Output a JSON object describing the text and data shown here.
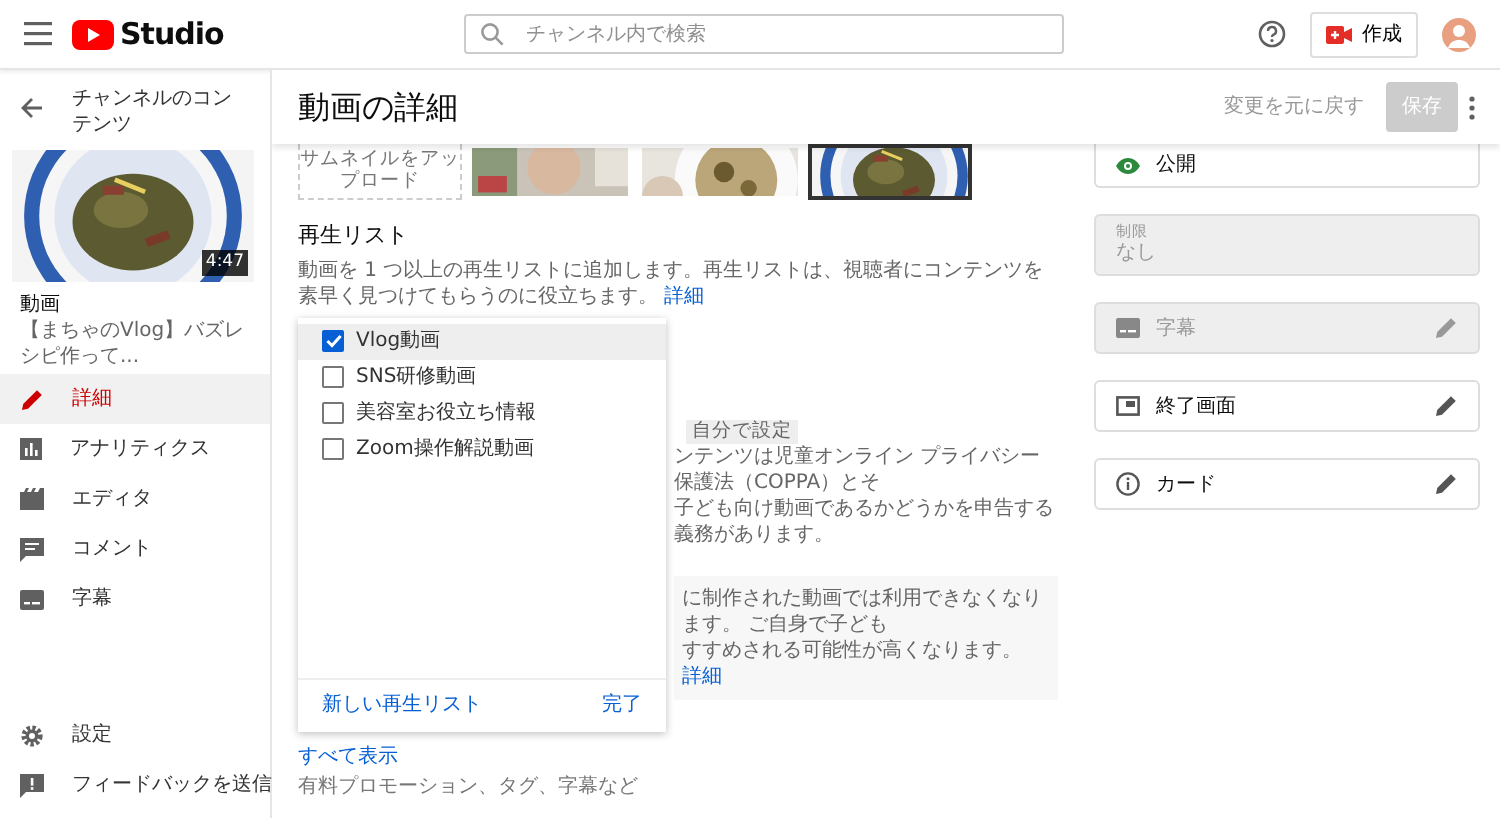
{
  "topbar": {
    "logo_text": "Studio",
    "search": {
      "placeholder": "チャンネル内で検索"
    },
    "create_button": "作成"
  },
  "sidebar": {
    "back_label": "チャンネルのコンテンツ",
    "video_duration": "4:47",
    "video_heading": "動画",
    "video_title": "【まちゃのVlog】バズレシピ作って...",
    "items": [
      {
        "label": "詳細",
        "selected": true
      },
      {
        "label": "アナリティクス",
        "selected": false
      },
      {
        "label": "エディタ",
        "selected": false
      },
      {
        "label": "コメント",
        "selected": false
      },
      {
        "label": "字幕",
        "selected": false
      }
    ],
    "footer_items": [
      {
        "label": "設定"
      },
      {
        "label": "フィードバックを送信"
      }
    ]
  },
  "header": {
    "title": "動画の詳細",
    "revert": "変更を元に戻す",
    "save": {
      "label": "保存",
      "disabled": true
    }
  },
  "thumbnails": {
    "upload_label": "サムネイルをアップロード",
    "items": [
      {
        "selected": false
      },
      {
        "selected": false
      },
      {
        "selected": true
      }
    ]
  },
  "playlists": {
    "title": "再生リスト",
    "description": "動画を 1 つ以上の再生リストに追加します。再生リストは、視聴者にコンテンツを素早く見つけてもらうのに役立ちます。",
    "link": "詳細",
    "dropdown": {
      "items": [
        {
          "label": "Vlog動画",
          "checked": true,
          "selected": true
        },
        {
          "label": "SNS研修動画",
          "checked": false,
          "selected": false
        },
        {
          "label": "美容室お役立ち情報",
          "checked": false,
          "selected": false
        },
        {
          "label": "Zoom操作解説動画",
          "checked": false,
          "selected": false
        }
      ],
      "new_playlist": "新しい再生リスト",
      "done": "完了"
    }
  },
  "audience": {
    "chip": "自分で設定",
    "lines": [
      "ンテンツは児童オンライン プライバシー保護法（COPPA）とそ",
      "子ども向け動画であるかどうかを申告する義務があります。"
    ],
    "notice_lines": [
      "に制作された動画では利用できなくなります。 ご自身で子ども",
      "すすめされる可能性が高くなります。"
    ],
    "notice_link": "詳細"
  },
  "show_all": "すべて表示",
  "show_all_hint": "有料プロモーション、タグ、字幕など",
  "right": {
    "visibility": "公開",
    "restriction": {
      "label": "制限",
      "value": "なし",
      "disabled": true
    },
    "cards": [
      {
        "label": "字幕",
        "disabled": true
      },
      {
        "label": "終了画面",
        "disabled": false
      },
      {
        "label": "カード",
        "disabled": false
      }
    ]
  }
}
